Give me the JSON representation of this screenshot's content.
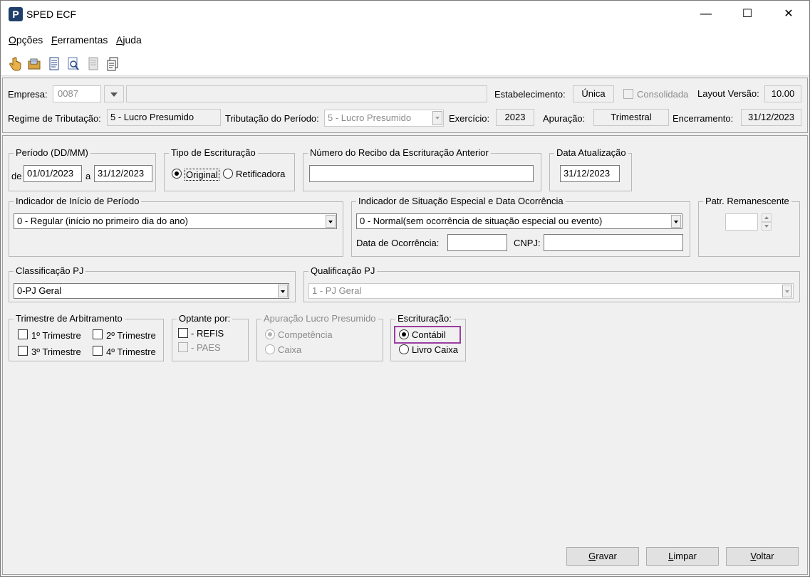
{
  "window": {
    "title": "SPED ECF",
    "app_icon_letter": "P",
    "minimize_glyph": "—",
    "maximize_glyph": "☐",
    "close_glyph": "✕"
  },
  "menu": {
    "items": [
      {
        "accel": "O",
        "rest": "pções"
      },
      {
        "accel": "F",
        "rest": "erramentas"
      },
      {
        "accel": "A",
        "rest": "juda"
      }
    ]
  },
  "toolbar": {
    "icons": [
      "hand-pointer-icon",
      "open-folder-icon",
      "document-icon",
      "preview-icon",
      "blank-page-icon",
      "copy-pages-icon"
    ]
  },
  "header": {
    "empresa_label": "Empresa:",
    "empresa_code": "0087",
    "empresa_name": "",
    "estabelecimento_label": "Estabelecimento:",
    "estabelecimento_value": "Única",
    "consolidada_label": "Consolidada",
    "layout_label": "Layout Versão:",
    "layout_value": "10.00",
    "regime_label": "Regime de Tributação:",
    "regime_value": "5 - Lucro Presumido",
    "tributacao_label": "Tributação do Período:",
    "tributacao_value": "5 - Lucro Presumido",
    "exercicio_label": "Exercício:",
    "exercicio_value": "2023",
    "apuracao_label": "Apuração:",
    "apuracao_value": "Trimestral",
    "encerramento_label": "Encerramento:",
    "encerramento_value": "31/12/2023"
  },
  "periodo": {
    "legend": "Período (DD/MM)",
    "de_label": "de",
    "de_value": "01/01/2023",
    "a_label": "a",
    "a_value": "31/12/2023"
  },
  "tipo_escrituracao": {
    "legend": "Tipo de Escrituração",
    "original_label": "Original",
    "retificadora_label": "Retificadora",
    "selected": "Original"
  },
  "recibo": {
    "legend": "Número do Recibo da Escrituração Anterior",
    "value": ""
  },
  "data_atualizacao": {
    "legend": "Data Atualização",
    "value": "31/12/2023"
  },
  "inicio_periodo": {
    "legend": "Indicador de Início de Período",
    "value": "0 - Regular (início no primeiro dia do ano)"
  },
  "situacao_especial": {
    "legend": "Indicador de Situação Especial e Data Ocorrência",
    "value": "0 - Normal(sem ocorrência de situação especial ou evento)",
    "data_ocorrencia_label": "Data de Ocorrência:",
    "data_ocorrencia_value": "",
    "cnpj_label": "CNPJ:",
    "cnpj_value": ""
  },
  "patr_remanescente": {
    "legend": "Patr. Remanescente",
    "value": ""
  },
  "classificacao": {
    "legend": "Classificação PJ",
    "value": "0-PJ Geral"
  },
  "qualificacao": {
    "legend": "Qualificação PJ",
    "value": "1 - PJ Geral"
  },
  "trimestre_arbitramento": {
    "legend": "Trimestre de Arbitramento",
    "t1": "1º Trimestre",
    "t2": "2º Trimestre",
    "t3": "3º Trimestre",
    "t4": "4º Trimestre"
  },
  "optante": {
    "legend": "Optante por:",
    "refis": "- REFIS",
    "paes": "- PAES"
  },
  "apuracao_lucro": {
    "legend": "Apuração Lucro Presumido",
    "competencia": "Competência",
    "caixa": "Caixa",
    "selected": "Competência"
  },
  "escrituracao": {
    "legend": "Escrituração:",
    "contabil": "Contábil",
    "livro_caixa": "Livro Caixa",
    "selected": "Contábil",
    "highlight_color": "#9b3ea0"
  },
  "buttons": {
    "gravar": {
      "accel": "G",
      "rest": "ravar"
    },
    "limpar": {
      "accel": "L",
      "rest": "impar"
    },
    "voltar": {
      "accel": "V",
      "rest": "oltar"
    }
  }
}
